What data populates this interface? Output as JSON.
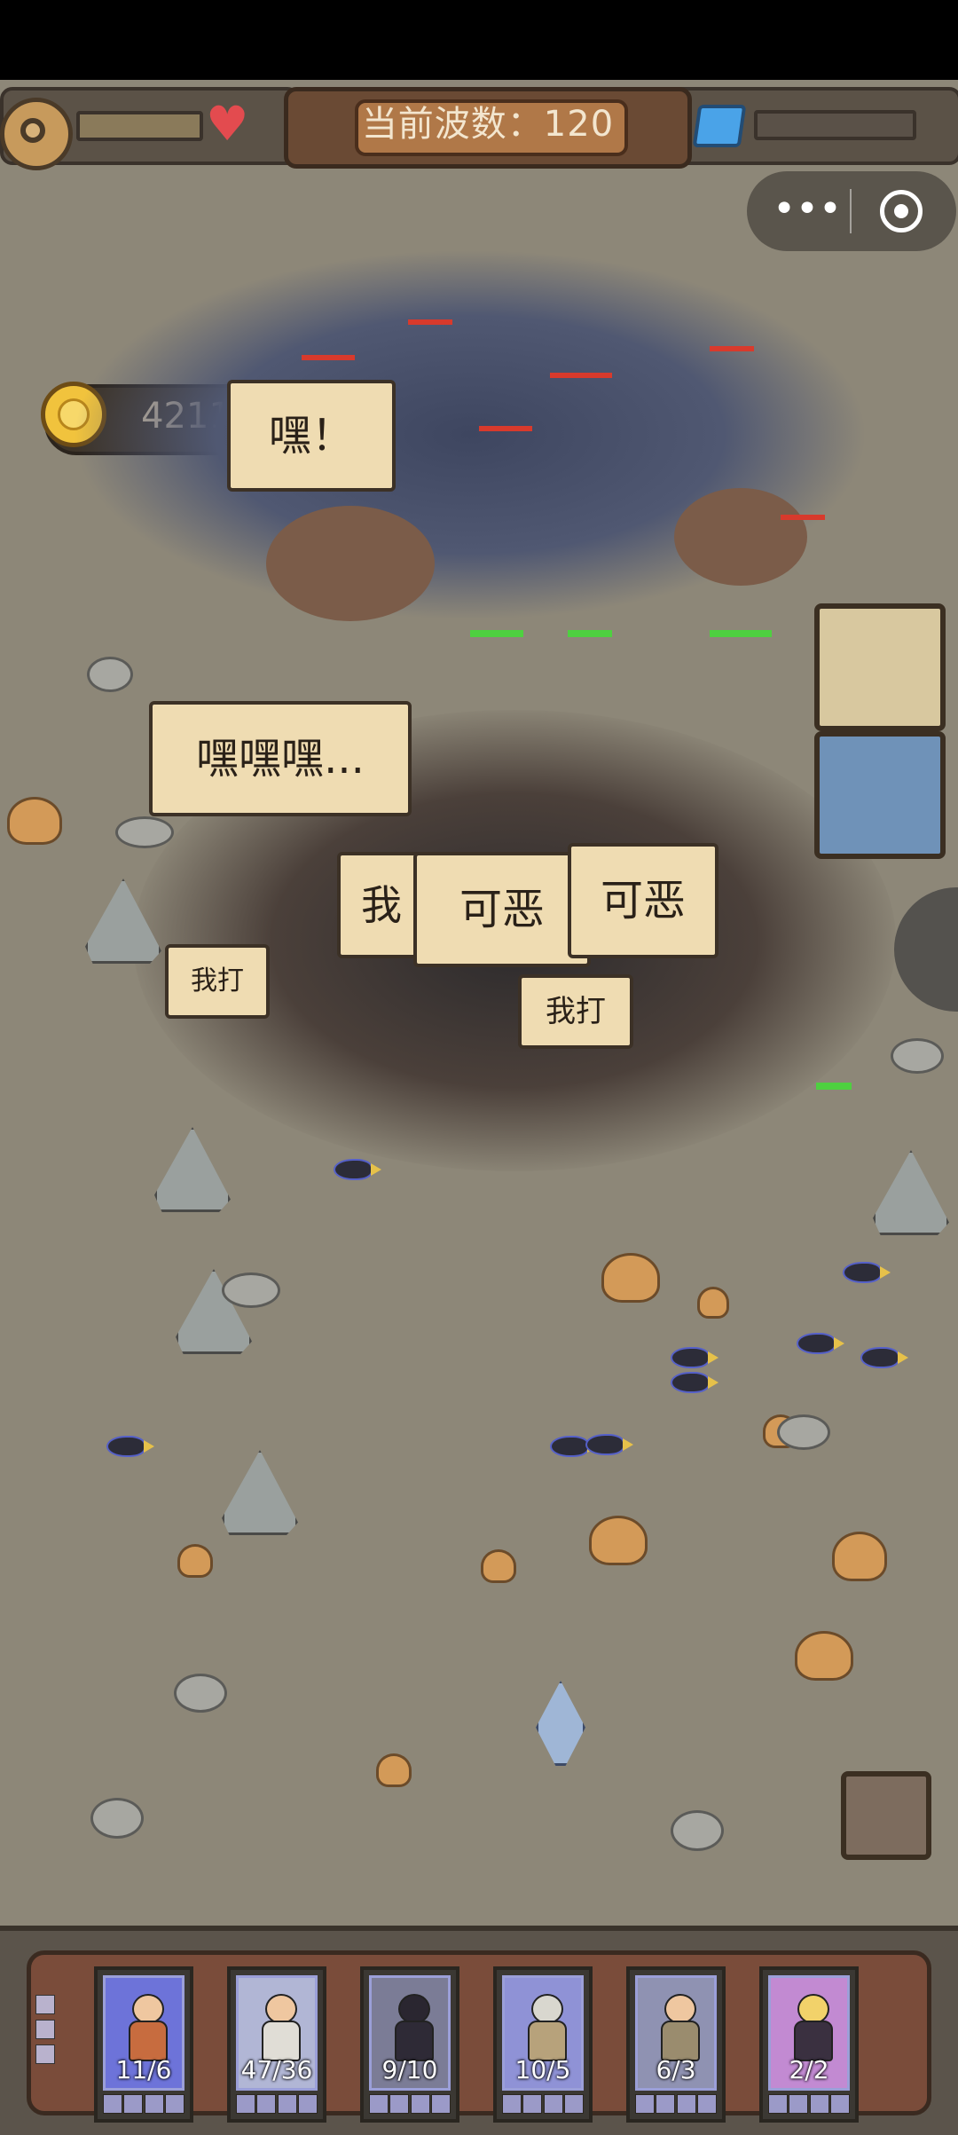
{
  "hud": {
    "wave_label": "当前波数：120",
    "coins": "4211",
    "more_icon": "more-dots-icon",
    "close_icon": "target-circle-icon"
  },
  "speech_bubbles": [
    {
      "id": "hey",
      "text": "嘿！"
    },
    {
      "id": "hehehe",
      "text": "嘿嘿嘿..."
    },
    {
      "id": "damn1",
      "text": "可恶"
    },
    {
      "id": "damn2",
      "text": "可恶"
    },
    {
      "id": "i-hit",
      "text": "我打"
    },
    {
      "id": "i",
      "text": "我"
    },
    {
      "id": "i2",
      "text": "我打"
    }
  ],
  "units": [
    {
      "count": "11/6",
      "color": "#6d73d9"
    },
    {
      "count": "47/36",
      "color": "#b1b6d5"
    },
    {
      "count": "9/10",
      "color": "#7b7c96"
    },
    {
      "count": "10/5",
      "color": "#8f92d6"
    },
    {
      "count": "6/3",
      "color": "#8f92b2"
    },
    {
      "count": "2/2",
      "color": "#c28ad2"
    }
  ],
  "colors": {
    "ground": "#8d8778",
    "hp_enemy": "#d83a2c",
    "hp_ally": "#4ed040",
    "bubble": "#efdcb2"
  }
}
